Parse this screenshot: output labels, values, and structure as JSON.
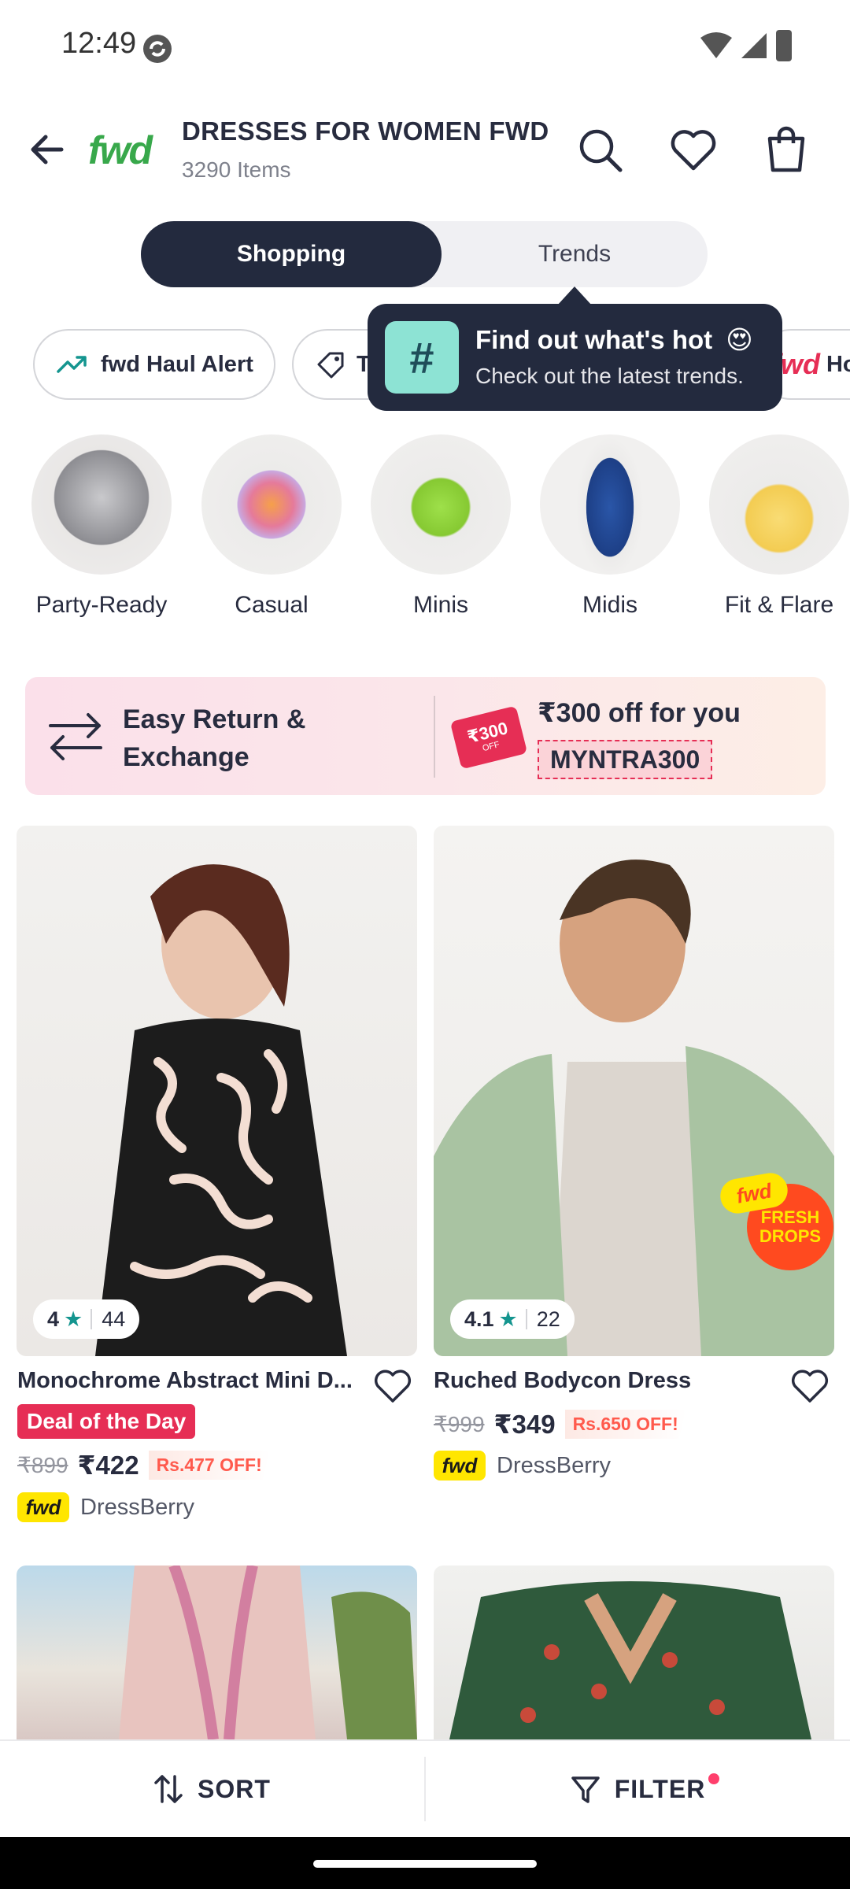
{
  "status_bar": {
    "time": "12:49"
  },
  "header": {
    "brand_logo": "fwd",
    "title": "DRESSES FOR WOMEN FWD",
    "item_count": "3290 Items"
  },
  "toggle": {
    "active": "Shopping",
    "inactive": "Trends"
  },
  "chips": [
    {
      "label": "fwd Haul Alert",
      "icon": "trending-up-icon"
    },
    {
      "label": "T",
      "icon": "tag-icon"
    },
    {
      "label": "Ho",
      "brand": "fwd"
    }
  ],
  "tooltip": {
    "title": "Find out what's hot",
    "emoji": "😍",
    "subtitle": "Check out the latest trends."
  },
  "categories": [
    {
      "label": "Party-Ready",
      "color": "#9a9a9e"
    },
    {
      "label": "Casual",
      "color": "#f29b4a"
    },
    {
      "label": "Minis",
      "color": "#8fd23b"
    },
    {
      "label": "Midis",
      "color": "#234a9a"
    },
    {
      "label": "Fit & Flare",
      "color": "#f7d566"
    }
  ],
  "banner": {
    "left_text": "Easy Return & Exchange",
    "offer_text": "₹300 off for you",
    "coupon_code": "MYNTRA300",
    "tag_text": "₹300",
    "tag_sub": "OFF"
  },
  "products": [
    {
      "name": "Monochrome Abstract Mini D...",
      "rating": "4",
      "reviews": "44",
      "deal": "Deal of the Day",
      "mrp": "₹899",
      "price": "₹422",
      "discount": "Rs.477 OFF!",
      "brand_badge": "fwd",
      "brand": "DressBerry"
    },
    {
      "name": "Ruched Bodycon Dress",
      "rating": "4.1",
      "reviews": "22",
      "mrp": "₹999",
      "price": "₹349",
      "discount": "Rs.650 OFF!",
      "brand_badge": "fwd",
      "brand": "DressBerry",
      "sticker_top": "fwd",
      "sticker_bottom": "FRESH DROPS"
    }
  ],
  "bottom_bar": {
    "sort_label": "SORT",
    "filter_label": "FILTER"
  },
  "colors": {
    "accent": "#e62e55",
    "dark": "#232a3e",
    "fwd_green": "#38a84b",
    "teal_star": "#14958f"
  }
}
